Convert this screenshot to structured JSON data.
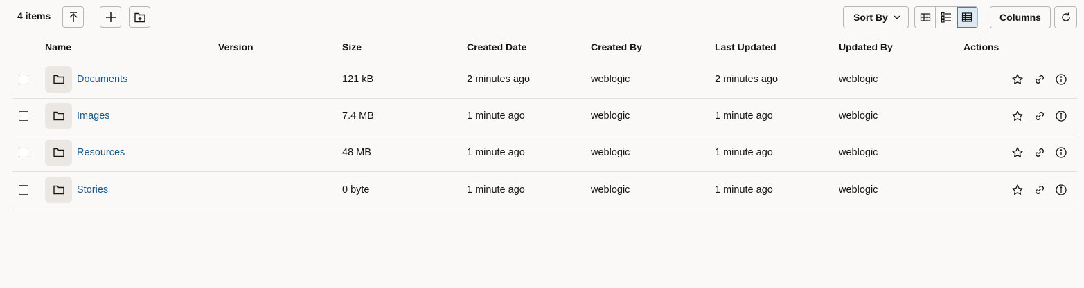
{
  "toolbar": {
    "item_count": "4 items",
    "sort_label": "Sort By",
    "columns_label": "Columns",
    "view_modes": [
      "card-view",
      "list-view",
      "table-view"
    ],
    "active_view": "table-view"
  },
  "table": {
    "headers": {
      "name": "Name",
      "version": "Version",
      "size": "Size",
      "created_date": "Created Date",
      "created_by": "Created By",
      "last_updated": "Last Updated",
      "updated_by": "Updated By",
      "actions": "Actions"
    },
    "rows": [
      {
        "name": "Documents",
        "version": "",
        "size": "121 kB",
        "created_date": "2 minutes ago",
        "created_by": "weblogic",
        "last_updated": "2 minutes ago",
        "updated_by": "weblogic"
      },
      {
        "name": "Images",
        "version": "",
        "size": "7.4 MB",
        "created_date": "1 minute ago",
        "created_by": "weblogic",
        "last_updated": "1 minute ago",
        "updated_by": "weblogic"
      },
      {
        "name": "Resources",
        "version": "",
        "size": "48 MB",
        "created_date": "1 minute ago",
        "created_by": "weblogic",
        "last_updated": "1 minute ago",
        "updated_by": "weblogic"
      },
      {
        "name": "Stories",
        "version": "",
        "size": "0 byte",
        "created_date": "1 minute ago",
        "created_by": "weblogic",
        "last_updated": "1 minute ago",
        "updated_by": "weblogic"
      }
    ]
  },
  "colors": {
    "link": "#1a5a8a",
    "background": "#faf9f8",
    "active_view_bg": "#dde9f3"
  }
}
